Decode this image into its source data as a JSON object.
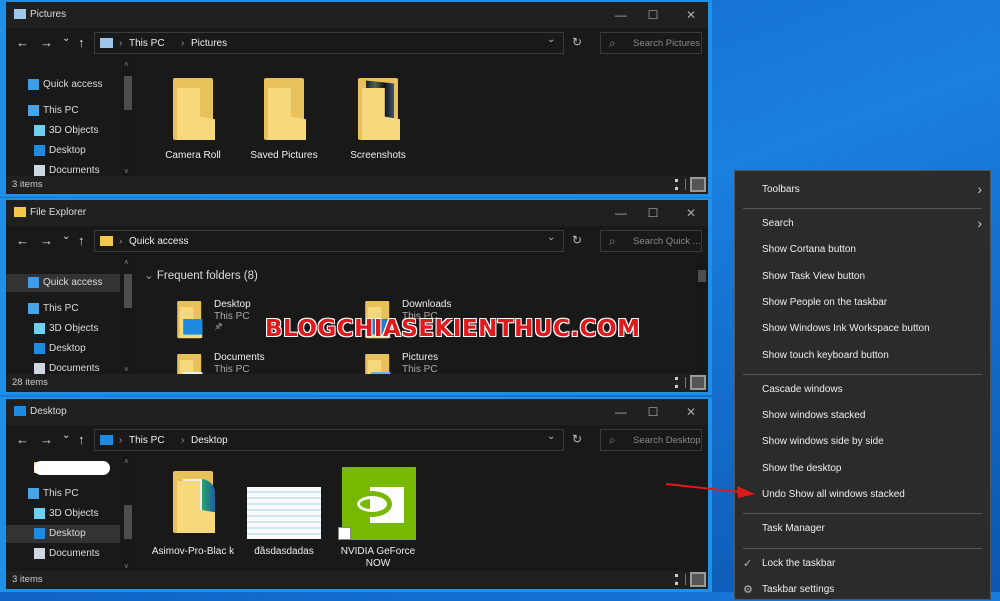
{
  "windows": [
    {
      "title": "Pictures",
      "icon": "pictures-icon",
      "crumbs": [
        "This PC",
        "Pictures"
      ],
      "search_placeholder": "Search Pictures",
      "status": "3 items",
      "nav": [
        {
          "label": "Quick access",
          "icon": "star-icon"
        },
        {
          "label": "This PC",
          "icon": "computer-icon"
        },
        {
          "label": "3D Objects",
          "icon": "cube-icon"
        },
        {
          "label": "Desktop",
          "icon": "desktop-icon"
        },
        {
          "label": "Documents",
          "icon": "document-icon"
        }
      ],
      "items": [
        {
          "label": "Camera Roll",
          "type": "folder"
        },
        {
          "label": "Saved Pictures",
          "type": "folder"
        },
        {
          "label": "Screenshots",
          "type": "folder-images"
        }
      ]
    },
    {
      "title": "File Explorer",
      "icon": "file-explorer-icon",
      "crumbs": [
        "Quick access"
      ],
      "search_placeholder": "Search Quick ...",
      "status": "28 items",
      "nav": [
        {
          "label": "Quick access",
          "icon": "star-icon",
          "selected": true
        },
        {
          "label": "This PC",
          "icon": "computer-icon"
        },
        {
          "label": "3D Objects",
          "icon": "cube-icon"
        },
        {
          "label": "Desktop",
          "icon": "desktop-icon"
        },
        {
          "label": "Documents",
          "icon": "document-icon"
        }
      ],
      "section": "Frequent folders (8)",
      "frequent": [
        {
          "name": "Desktop",
          "location": "This PC",
          "pinned": true
        },
        {
          "name": "Downloads",
          "location": "This PC"
        },
        {
          "name": "Documents",
          "location": "This PC"
        },
        {
          "name": "Pictures",
          "location": "This PC"
        }
      ]
    },
    {
      "title": "Desktop",
      "icon": "desktop-icon",
      "crumbs": [
        "This PC",
        "Desktop"
      ],
      "search_placeholder": "Search Desktop",
      "status": "3 items",
      "nav": [
        {
          "label": "",
          "icon": "folder-icon",
          "redacted": true
        },
        {
          "label": "This PC",
          "icon": "computer-icon"
        },
        {
          "label": "3D Objects",
          "icon": "cube-icon"
        },
        {
          "label": "Desktop",
          "icon": "desktop-icon",
          "selected": true
        },
        {
          "label": "Documents",
          "icon": "document-icon"
        }
      ],
      "items": [
        {
          "label": "Asimov-Pro-Blac k",
          "type": "folder-doc"
        },
        {
          "label": "đâsdasdadas",
          "type": "image"
        },
        {
          "label": "NVIDIA GeForce NOW",
          "type": "nvidia"
        }
      ]
    }
  ],
  "context_menu": {
    "groups": [
      [
        {
          "label": "Toolbars",
          "submenu": true
        }
      ],
      [
        {
          "label": "Search",
          "submenu": true
        },
        {
          "label": "Show Cortana button"
        },
        {
          "label": "Show Task View button"
        },
        {
          "label": "Show People on the taskbar"
        },
        {
          "label": "Show Windows Ink Workspace button"
        },
        {
          "label": "Show touch keyboard button"
        }
      ],
      [
        {
          "label": "Cascade windows"
        },
        {
          "label": "Show windows stacked"
        },
        {
          "label": "Show windows side by side"
        },
        {
          "label": "Show the desktop"
        },
        {
          "label": "Undo Show all windows stacked",
          "highlighted_by_arrow": true
        }
      ],
      [
        {
          "label": "Task Manager"
        }
      ],
      [
        {
          "label": "Lock the taskbar",
          "checked": true
        },
        {
          "label": "Taskbar settings",
          "icon": "gear-icon"
        }
      ]
    ]
  },
  "watermark": "BLOGCHIASEKIENTHUC.COM",
  "colors": {
    "accent": "#1e90e6",
    "arrow": "#e0191c",
    "folder": "#f7d87c",
    "nvidia": "#76b900"
  }
}
